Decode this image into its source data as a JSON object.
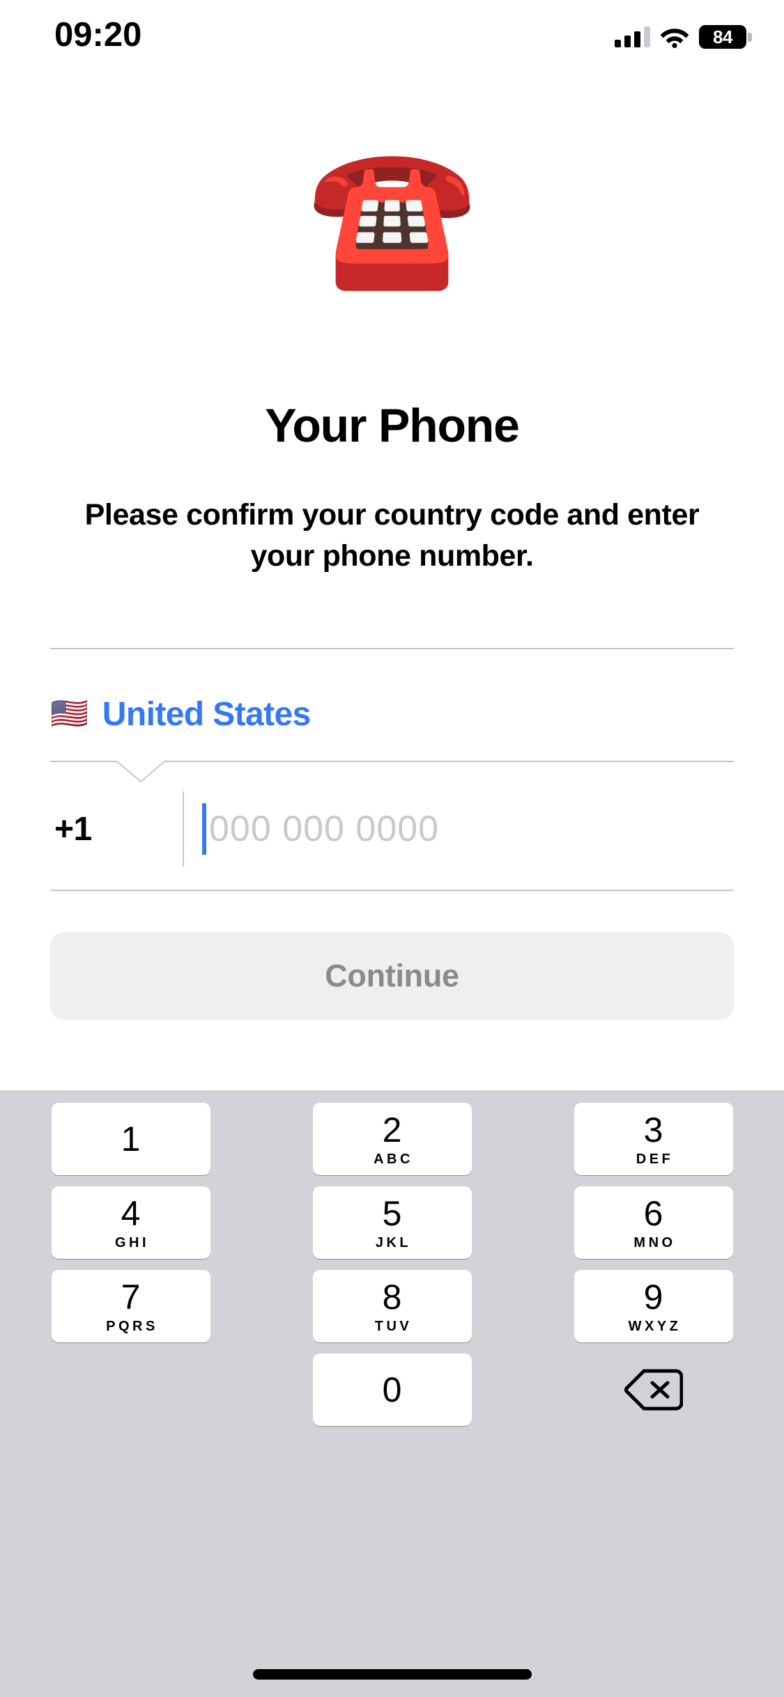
{
  "status_bar": {
    "time": "09:20",
    "battery_level": "84",
    "signal_icon": "cellular-signal-icon",
    "wifi_icon": "wifi-icon",
    "battery_icon": "battery-icon"
  },
  "hero": {
    "emoji": "☎️",
    "emoji_name": "telephone-emoji"
  },
  "page": {
    "title": "Your Phone",
    "subtitle": "Please confirm your country code and enter your phone number."
  },
  "country": {
    "flag": "🇺🇸",
    "name": "United States",
    "accent_color": "#3478F6"
  },
  "phone": {
    "dial_code": "+1",
    "value": "",
    "placeholder": "000 000 0000",
    "cursor_color": "#3478F6",
    "placeholder_color": "#C8C8CD"
  },
  "continue": {
    "label": "Continue",
    "enabled": false,
    "bg_color": "#EFEFEF",
    "text_color": "#8A8A8E"
  },
  "keypad": {
    "bg_color": "#D1D3D9",
    "keys": [
      {
        "digit": "1",
        "letters": ""
      },
      {
        "digit": "2",
        "letters": "ABC"
      },
      {
        "digit": "3",
        "letters": "DEF"
      },
      {
        "digit": "4",
        "letters": "GHI"
      },
      {
        "digit": "5",
        "letters": "JKL"
      },
      {
        "digit": "6",
        "letters": "MNO"
      },
      {
        "digit": "7",
        "letters": "PQRS"
      },
      {
        "digit": "8",
        "letters": "TUV"
      },
      {
        "digit": "9",
        "letters": "WXYZ"
      },
      {
        "digit": "0",
        "letters": ""
      }
    ],
    "backspace_icon": "backspace-icon"
  }
}
